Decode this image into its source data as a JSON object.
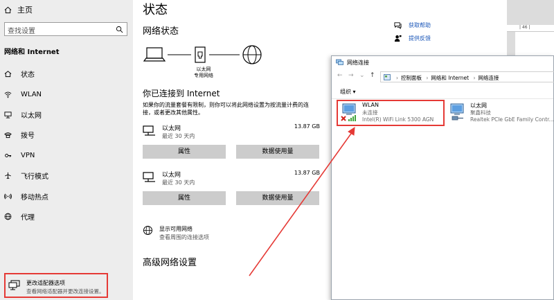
{
  "sidebar": {
    "home": "主页",
    "search_placeholder": "查找设置",
    "section_title": "网络和 Internet",
    "items": [
      {
        "label": "状态",
        "icon": "home-network-icon"
      },
      {
        "label": "WLAN",
        "icon": "wifi-icon"
      },
      {
        "label": "以太网",
        "icon": "ethernet-icon"
      },
      {
        "label": "拨号",
        "icon": "dialup-icon"
      },
      {
        "label": "VPN",
        "icon": "vpn-icon"
      },
      {
        "label": "飞行模式",
        "icon": "airplane-icon"
      },
      {
        "label": "移动热点",
        "icon": "hotspot-icon"
      },
      {
        "label": "代理",
        "icon": "globe-icon"
      }
    ]
  },
  "main": {
    "title": "状态",
    "network_status_heading": "网络状态",
    "diagram_label_line1": "以太网",
    "diagram_label_line2": "专用网络",
    "connected_heading": "你已连接到 Internet",
    "connected_desc": "如果你的流量套餐有限制，则你可以将此网络设置为按流量计费的连接，或者更改其他属性。",
    "connections": [
      {
        "name": "以太网",
        "sub": "最近 30 天内",
        "size": "13.87 GB",
        "btn_properties": "属性",
        "btn_data_usage": "数据使用量"
      },
      {
        "name": "以太网",
        "sub": "最近 30 天内",
        "size": "13.87 GB",
        "btn_properties": "属性",
        "btn_data_usage": "数据使用量"
      }
    ],
    "show_available": {
      "name": "显示可用网络",
      "sub": "查看周围的连接选项"
    },
    "advanced_heading": "高级网络设置",
    "change_adapter": {
      "name": "更改适配器选项",
      "sub": "查看网络适配器并更改连接设置。"
    },
    "help": {
      "get_help": "获取帮助",
      "feedback": "提供反馈"
    }
  },
  "bg_doc": {
    "ruler_text": "| 46 |"
  },
  "network_connections_window": {
    "title": "网络连接",
    "breadcrumb": [
      "控制面板",
      "网络和 Internet",
      "网络连接"
    ],
    "toolbar_organize": "组织 ▾",
    "adapters": [
      {
        "name": "WLAN",
        "status": "未连接",
        "device": "Intel(R) WiFi Link 5300 AGN",
        "disconnected": true
      },
      {
        "name": "以太网",
        "status": "聚鑫科技",
        "device": "Realtek PCIe GbE Family Contr...",
        "disconnected": false
      }
    ]
  },
  "colors": {
    "annotation_red": "#e53935",
    "link_blue": "#1a56b8",
    "sidebar_bg": "#ededed",
    "button_gray": "#cccccc"
  }
}
